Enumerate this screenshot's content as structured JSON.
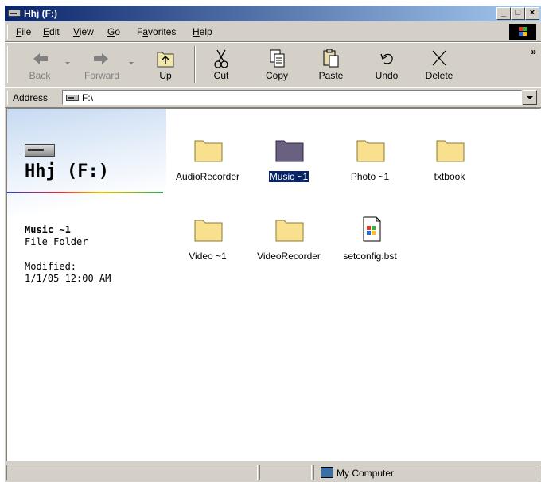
{
  "window": {
    "title": "Hhj (F:)",
    "buttons": {
      "minimize": "_",
      "maximize": "□",
      "close": "×"
    }
  },
  "menu": [
    "File",
    "Edit",
    "View",
    "Go",
    "Favorites",
    "Help"
  ],
  "menu_mnemonics": [
    "F",
    "E",
    "V",
    "G",
    "a",
    "H"
  ],
  "toolbar": {
    "back": "Back",
    "forward": "Forward",
    "up": "Up",
    "cut": "Cut",
    "copy": "Copy",
    "paste": "Paste",
    "undo": "Undo",
    "delete": "Delete",
    "overflow": "»"
  },
  "address": {
    "label": "Address",
    "value": "F:\\"
  },
  "info_pane": {
    "drive_title": "Hhj (F:)",
    "selected_name": "Music ~1",
    "selected_type": "File Folder",
    "modified_label": "Modified:",
    "modified_date": "1/1/05 12:00 AM"
  },
  "files": [
    {
      "name": "AudioRecorder",
      "type": "folder",
      "selected": false
    },
    {
      "name": "Music ~1",
      "type": "folder",
      "selected": true
    },
    {
      "name": "Photo ~1",
      "type": "folder",
      "selected": false
    },
    {
      "name": "txtbook",
      "type": "folder",
      "selected": false
    },
    {
      "name": "Video ~1",
      "type": "folder",
      "selected": false
    },
    {
      "name": "VideoRecorder",
      "type": "folder",
      "selected": false
    },
    {
      "name": "setconfig.bst",
      "type": "file",
      "selected": false
    }
  ],
  "status": {
    "zone": "My Computer"
  },
  "colors": {
    "titlebar": "#0a246a",
    "selection": "#0a246a",
    "folder": "#f8e08e",
    "folder_selected": "#6a6080"
  }
}
